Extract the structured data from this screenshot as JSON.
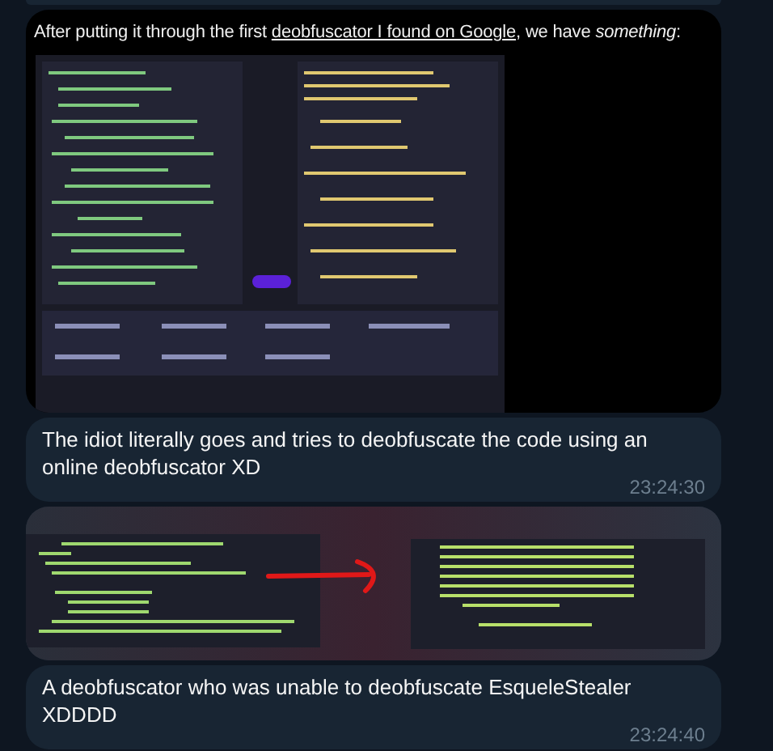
{
  "messages": [
    {
      "caption_before": "After putting it through the first ",
      "link": "deobfuscator I found on Google",
      "caption_after": ", we have *something*:",
      "picture": {
        "kind": "picture"
      }
    },
    {
      "kind": "text",
      "text": "The idiot literally goes and tries to deobfuscate the code using an online deobfuscator XD",
      "time": "23:24:30"
    },
    {
      "picture": {
        "kind": "picture"
      }
    },
    {
      "kind": "text",
      "text": "A deobfuscator who was unable to deobfuscate EsqueleStealer XDDDD",
      "time": "23:24:40"
    }
  ]
}
